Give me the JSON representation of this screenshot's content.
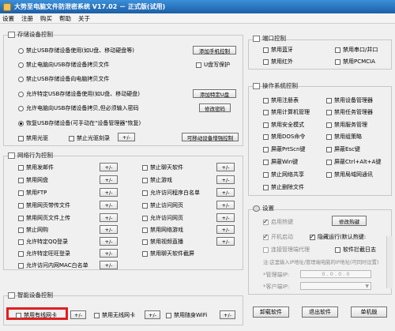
{
  "titlebar": {
    "title": "大势至电脑文件防泄密系统 V17.02 － 正式版(试用)"
  },
  "menu": [
    "设置",
    "注册",
    "购买",
    "帮助",
    "关于"
  ],
  "storage": {
    "title": "存储设备控制",
    "options": [
      {
        "label": "禁止USB存储设备使用(如U盘、移动硬盘等)",
        "checked": false
      },
      {
        "label": "禁止电脑向USB存储设备拷贝文件",
        "checked": false
      },
      {
        "label": "禁止USB存储设备向电脑拷贝文件",
        "checked": false
      },
      {
        "label": "允许特定USB存储设备使用(如U盘、移动硬盘)",
        "checked": false
      },
      {
        "label": "允许电脑向USB存储设备拷贝,但必须输入密码",
        "checked": false
      },
      {
        "label": "恢复USB存储设备(可手动在\"设备管理器\"恢复)",
        "checked": true
      }
    ],
    "btn_add_phone": "添加手机控制",
    "u_protect": "U盘写保护",
    "btn_add_usb": "添加特定U盘",
    "btn_change_pw": "修改密码",
    "cd_disable": "禁用光驱",
    "cd_burn": "禁止光驱刻录",
    "pm": "+/-",
    "btn_device_ctrl": "可移动设备增强控制"
  },
  "network": {
    "title": "网络行为控制",
    "pm": "+/-",
    "left": [
      "禁用发邮件",
      "禁用网盘",
      "禁用FTP",
      "禁用网页带传文件",
      "禁用网页文件上传",
      "禁止网购",
      "允许特定QQ登录",
      "允许特定旺旺登录",
      "允许访问内网MAC白名单"
    ],
    "right": [
      "禁止聊天软件",
      "禁止游戏",
      "允许访问程序白名单",
      "禁止访问网页",
      "允许访问网页",
      "禁用网络游戏",
      "禁用视频直播",
      "禁用聊天软件截屏"
    ]
  },
  "smart": {
    "title": "智能设备控制",
    "items": [
      "禁用有线网卡",
      "禁用无线网卡",
      "禁用随身WiFi"
    ],
    "pm": "+/-"
  },
  "port": {
    "title": "端口控制",
    "items": [
      "禁用蓝牙",
      "禁用串口/并口",
      "禁用红外",
      "禁用PCMCIA"
    ]
  },
  "os": {
    "title": "操作系统控制",
    "left": [
      "禁用注册表",
      "禁用计算机管理",
      "禁用安全模式",
      "禁用DOS命令",
      "屏蔽PrtScn键",
      "屏蔽Win键",
      "禁止网络共享",
      "禁止删除文件"
    ],
    "right": [
      "禁用设备管理器",
      "禁用任务管理器",
      "禁用服务管理",
      "禁用组策略",
      "屏蔽Esc键",
      "屏蔽Ctrl+Alt+A键",
      "禁用局域网通讯"
    ]
  },
  "settings": {
    "title": "设置",
    "autostart": "启用热键",
    "btn_hotkey": "修改热键",
    "boot": "开机启动",
    "hidden": "隐藏运行(默认热键:",
    "connect": "连接管理端代理",
    "log": "软件拦截日志",
    "hint": "注:这里输入IP地址/管理端电脑的IP地址(可同时设置)",
    "admin_label": "*管理端IP:",
    "admin_value": "0 . 0 . 0 . 0",
    "client_label": "*客户端IP:"
  },
  "footer": {
    "uninstall": "卸载软件",
    "exit": "退出软件",
    "standalone": "单机版"
  }
}
